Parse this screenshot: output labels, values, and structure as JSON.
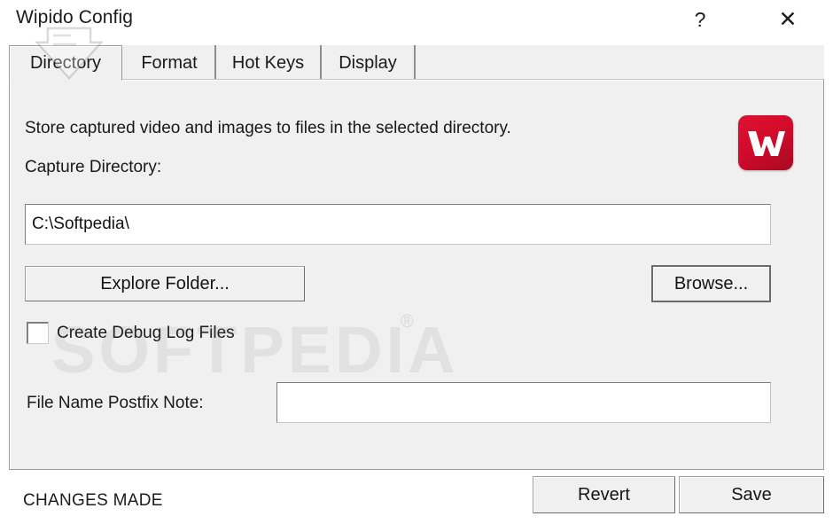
{
  "window": {
    "title": "Wipido Config",
    "help_glyph": "?",
    "close_glyph": "✕"
  },
  "tabs": [
    {
      "label": "Directory",
      "selected": true
    },
    {
      "label": "Format",
      "selected": false
    },
    {
      "label": "Hot Keys",
      "selected": false
    },
    {
      "label": "Display",
      "selected": false
    }
  ],
  "directory_tab": {
    "description": "Store captured video and images to files in the selected directory.",
    "capture_directory_label": "Capture Directory:",
    "capture_directory_value": "C:\\Softpedia\\",
    "capture_directory_placeholder": "",
    "explore_folder_button": "Explore Folder...",
    "browse_button": "Browse...",
    "debug_checkbox_label": "Create Debug Log Files",
    "debug_checkbox_checked": false,
    "postfix_label": "File Name Postfix Note:",
    "postfix_value": "",
    "postfix_placeholder": ""
  },
  "footer": {
    "status": "CHANGES MADE",
    "revert_button": "Revert",
    "save_button": "Save"
  },
  "watermark": {
    "text": "SOFTPEDIA",
    "registered_mark": "®"
  },
  "colors": {
    "logo_red": "#d20b2c",
    "window_bg": "#ffffff",
    "panel_bg": "#f0f0f0",
    "text": "#181818",
    "border": "#9c9c9c"
  }
}
